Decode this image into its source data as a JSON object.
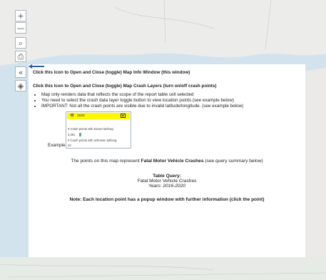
{
  "map": {
    "zoom_in_icon": "+",
    "zoom_out_icon": "—",
    "search_icon": "⌕",
    "print_icon": "⎙",
    "collapse_icon": "«",
    "layers_icon": "◈"
  },
  "info_window": {
    "toggle_info_text": "Click this Icon to Open and Close (toggle) Map Info Window (this window)",
    "toggle_layers_text": "Click this Icon to Open and Close (toggle) Map Crash Layers (turn on/off crash points)",
    "bullets": [
      "Map only renders data that reflects the scope of the report table cell selected",
      "You need to select the crash data layer toggle button to view location points (see example below)",
      "IMPORTANT: Not all the crash points are visible due to invalid latitude/longitude. (see example below)"
    ],
    "example_label": "Example:",
    "example": {
      "year": "2020",
      "known_label": "# Crash points with known lat/long:",
      "known_value": "3,351",
      "unknown_label": "# Crash points with unknown lat/long:",
      "unknown_value": "23"
    },
    "represent_prefix": "The points on this map represent ",
    "represent_bold": "Fatal Motor Vehicle Crashes",
    "represent_suffix": " (see query summary below)",
    "query_title": "Table Query:",
    "query_subject": "Fatal Motor Vehicle Crashes",
    "query_years_label": "Years: ",
    "query_years_value": "2016-2020",
    "note": "Note: Each location point has a popup window with further information (click the point)"
  },
  "colors": {
    "arrow": "#2e5fa8",
    "highlight": "#fff700",
    "water": "#d3e3ee",
    "land": "#ececea"
  }
}
